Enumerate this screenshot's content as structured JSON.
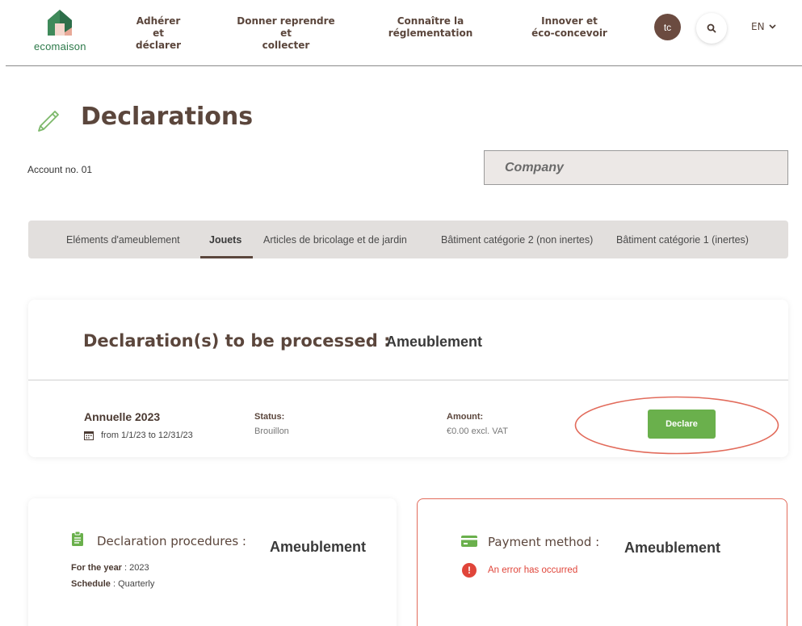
{
  "header": {
    "logo_text": "ecomaison",
    "nav": [
      {
        "label": "Adhérer et\ndéclarer"
      },
      {
        "label": "Donner reprendre et\ncollecter"
      },
      {
        "label": "Connaître la\nréglementation"
      },
      {
        "label": "Innover et\néco-concevoir"
      }
    ],
    "avatar_initials": "tc",
    "search_icon": "search-icon",
    "language": "EN"
  },
  "page": {
    "title": "Declarations",
    "account_label": "Account no. 01",
    "company_placeholder": "Company"
  },
  "tabs": [
    {
      "label": "Eléments d'ameublement",
      "active": false
    },
    {
      "label": "Jouets",
      "active": true
    },
    {
      "label": "Articles de bricolage et de jardin",
      "active": false
    },
    {
      "label": "Bâtiment catégorie 2 (non inertes)",
      "active": false
    },
    {
      "label": "Bâtiment catégorie 1 (inertes)",
      "active": false
    }
  ],
  "processing": {
    "title": "Declaration(s) to be processed :",
    "category": "Ameublement",
    "declaration": {
      "name": "Annuelle 2023",
      "period": "from 1/1/23 to 12/31/23",
      "status_label": "Status:",
      "status_value": "Brouillon",
      "amount_label": "Amount:",
      "amount_value": "€0.00 excl. VAT",
      "action_label": "Declare"
    }
  },
  "procedures": {
    "title": "Declaration procedures :",
    "category": "Ameublement",
    "year_label": "For the year",
    "year_value": "2023",
    "schedule_label": "Schedule",
    "schedule_value": "Quarterly"
  },
  "payment": {
    "title": "Payment method :",
    "category": "Ameublement",
    "error": "An error has occurred"
  },
  "colors": {
    "brand_brown": "#5b463c",
    "accent_green": "#6ab04c",
    "error_red": "#e0453a",
    "highlight_ellipse": "#e26b5b"
  }
}
